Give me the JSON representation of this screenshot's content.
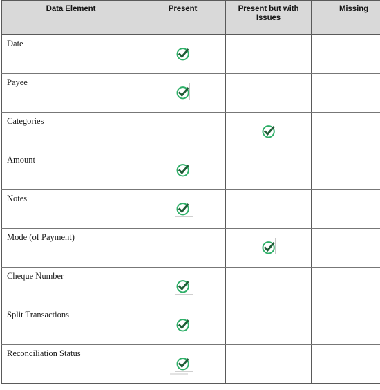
{
  "table": {
    "columns": [
      {
        "key": "data_element",
        "label": "Data Element"
      },
      {
        "key": "present",
        "label": "Present"
      },
      {
        "key": "present_with_issues",
        "label": "Present but with Issues"
      },
      {
        "key": "missing",
        "label": "Missing"
      }
    ],
    "rows": [
      {
        "label": "Date",
        "status": "present"
      },
      {
        "label": "Payee",
        "status": "present"
      },
      {
        "label": "Categories",
        "status": "present_with_issues"
      },
      {
        "label": "Amount",
        "status": "present"
      },
      {
        "label": "Notes",
        "status": "present"
      },
      {
        "label": "Mode (of Payment)",
        "status": "present_with_issues"
      },
      {
        "label": "Cheque Number",
        "status": "present"
      },
      {
        "label": "Split Transactions",
        "status": "present"
      },
      {
        "label": "Reconciliation Status",
        "status": "present"
      }
    ]
  },
  "icons": {
    "check": "check-circle-icon"
  },
  "colors": {
    "header_background": "#d9d9d9",
    "border": "#5a5a5a",
    "row_border": "#777777",
    "check_ring": "#2eaf68",
    "check_mark": "#1f5c36",
    "text": "#1a1a1a",
    "page_background": "#ffffff"
  }
}
